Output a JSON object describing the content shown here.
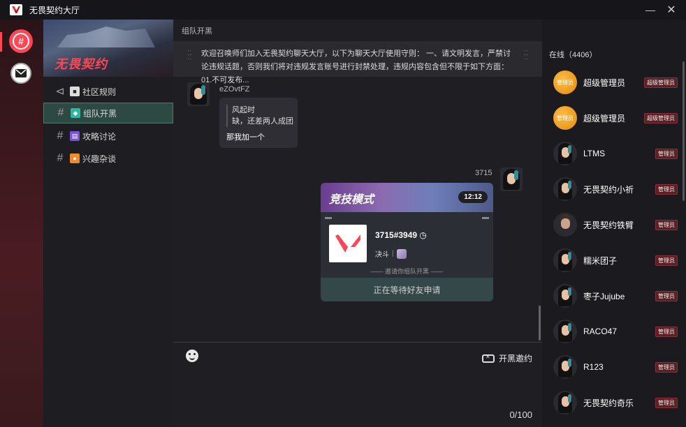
{
  "app": {
    "title": "无畏契约大厅",
    "minimize": "—",
    "close": "✕"
  },
  "sidebar": {
    "banner_logo": "无畏契约",
    "channels": [
      {
        "label": "社区规则",
        "prefix": "⊲"
      },
      {
        "label": "组队开黑",
        "prefix": "#"
      },
      {
        "label": "攻略讨论",
        "prefix": "#"
      },
      {
        "label": "兴趣杂谈",
        "prefix": "#"
      }
    ]
  },
  "main": {
    "header": "组队开黑",
    "more": "•••",
    "notice": "欢迎召唤师们加入无畏契约聊天大厅，以下为聊天大厅使用守则： 一、请文明发言，严禁讨论违规话题，否则我们将对违规发言账号进行封禁处理，违规内容包含但不限于如下方面： 01.不可发布...",
    "messages": [
      {
        "author": "eZOvtFZ",
        "quote_line1": "风起时",
        "quote_line2": "缺，还差两人成团",
        "text": "那我加一个"
      },
      {
        "author": "3715"
      }
    ],
    "card": {
      "mode": "竞技模式",
      "time": "12:12",
      "player": "3715#3949",
      "rank": "决斗",
      "invite_note": "邀请你组队开黑",
      "status": "正在等待好友申请"
    },
    "composer": {
      "team_invite": "开黑邀约",
      "char_count": "0/100"
    }
  },
  "members": {
    "header": "在线（4406）",
    "list": [
      {
        "name": "超级管理员",
        "tag": "超级管理员",
        "avatar": "gold",
        "avatar_text": "管理员"
      },
      {
        "name": "超级管理员",
        "tag": "超级管理员",
        "avatar": "gold",
        "avatar_text": "管理员"
      },
      {
        "name": "LTMS",
        "tag": "管理员",
        "avatar": "agent"
      },
      {
        "name": "无畏契约小祈",
        "tag": "管理员",
        "avatar": "agent"
      },
      {
        "name": "无畏契约铁臂",
        "tag": "管理员",
        "avatar": "man"
      },
      {
        "name": "糯米团子",
        "tag": "管理员",
        "avatar": "agent"
      },
      {
        "name": "枣子Jujube",
        "tag": "管理员",
        "avatar": "agent"
      },
      {
        "name": "RACO47",
        "tag": "管理员",
        "avatar": "agent"
      },
      {
        "name": "R123",
        "tag": "管理员",
        "avatar": "agent"
      },
      {
        "name": "无畏契约奇乐",
        "tag": "管理员",
        "avatar": "agent"
      }
    ]
  },
  "colors": {
    "accent": "#ff4655",
    "selected_channel": "#2c4a42",
    "admin_tag": "#5a2024"
  }
}
